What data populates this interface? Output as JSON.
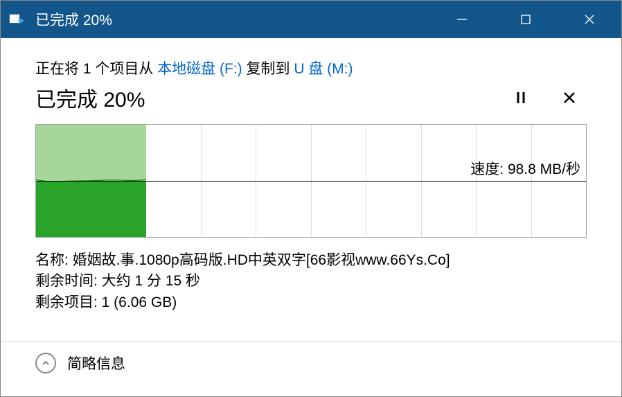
{
  "titlebar": {
    "title": "已完成 20%"
  },
  "copy_desc": {
    "prefix": "正在将 1 个项目从 ",
    "source": "本地磁盘 (F:)",
    "middle": " 复制到 ",
    "dest": "U 盘 (M:)"
  },
  "progress": {
    "title": "已完成 20%",
    "percent": 20
  },
  "chart_data": {
    "type": "area",
    "title": "",
    "xlabel": "",
    "ylabel": "",
    "progress_percent": 20,
    "grid_columns": 10,
    "speed_label": "速度: 98.8 MB/秒",
    "speed_value": 98.8,
    "speed_unit": "MB/秒",
    "ylim": [
      0,
      200
    ],
    "x": [
      0,
      2,
      4,
      6,
      8,
      10,
      12,
      14,
      16,
      18,
      20
    ],
    "series": [
      {
        "name": "speed",
        "values": [
          100,
          96,
          94,
          96,
          98,
          97,
          98,
          99,
          98,
          99,
          99
        ]
      }
    ]
  },
  "details": {
    "name_label": "名称: ",
    "name_value": "婚姻故.事.1080p高码版.HD中英双字[66影视www.66Ys.Co]",
    "time_label": "剩余时间: ",
    "time_value": "大约 1 分 15 秒",
    "items_label": "剩余项目: ",
    "items_value": "1 (6.06 GB)"
  },
  "footer": {
    "label": "简略信息"
  }
}
